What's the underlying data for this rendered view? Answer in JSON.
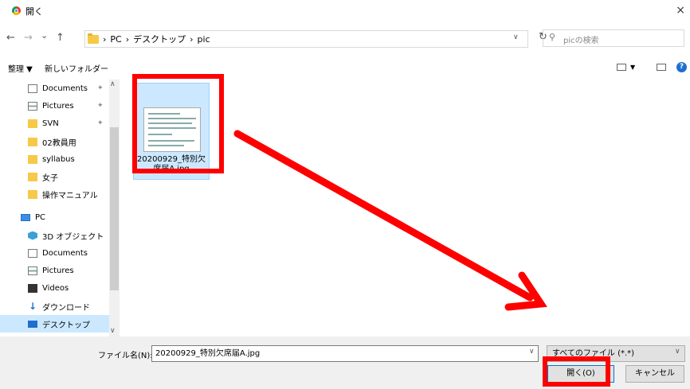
{
  "titlebar": {
    "title": "開く",
    "close": "×"
  },
  "nav": {
    "back": "←",
    "forward": "→",
    "recent": "⌄",
    "up": "↑",
    "breadcrumb": [
      "PC",
      "デスクトップ",
      "pic"
    ],
    "sep": "›",
    "refresh": "↻",
    "search_placeholder": "picの検索"
  },
  "toolbar": {
    "organize": "整理 ▼",
    "new_folder": "新しいフォルダー",
    "help": "?"
  },
  "sidebar": {
    "items": [
      {
        "label": "Documents",
        "icon": "document-icon",
        "pinned": true
      },
      {
        "label": "Pictures",
        "icon": "pictures-icon",
        "pinned": true
      },
      {
        "label": "SVN",
        "icon": "folder-icon",
        "pinned": true
      },
      {
        "label": "02教員用",
        "icon": "folder-icon"
      },
      {
        "label": "syllabus",
        "icon": "folder-icon"
      },
      {
        "label": "女子",
        "icon": "folder-icon"
      },
      {
        "label": "操作マニュアル",
        "icon": "folder-icon"
      },
      {
        "label": "PC",
        "icon": "pc-icon"
      },
      {
        "label": "3D オブジェクト",
        "icon": "3d-objects-icon"
      },
      {
        "label": "Documents",
        "icon": "document-icon"
      },
      {
        "label": "Pictures",
        "icon": "pictures-icon"
      },
      {
        "label": "Videos",
        "icon": "videos-icon"
      },
      {
        "label": "ダウンロード",
        "icon": "download-icon"
      },
      {
        "label": "デスクトップ",
        "icon": "desktop-icon",
        "selected": true
      }
    ],
    "pin_glyph": "✦"
  },
  "files": [
    {
      "name": "20200929_特別欠席届A.jpg",
      "name_line1": "20200929_特別欠",
      "name_line2": "席届A.jpg",
      "selected": true
    }
  ],
  "bottom": {
    "filename_label": "ファイル名(N):",
    "filename_value": "20200929_特別欠席届A.jpg",
    "filetype": "すべてのファイル (*.*)",
    "open_button": "開く(O)",
    "cancel_button": "キャンセル"
  },
  "colors": {
    "highlight": "#ff0000",
    "selection": "#cce8ff",
    "accent": "#0078d7"
  }
}
